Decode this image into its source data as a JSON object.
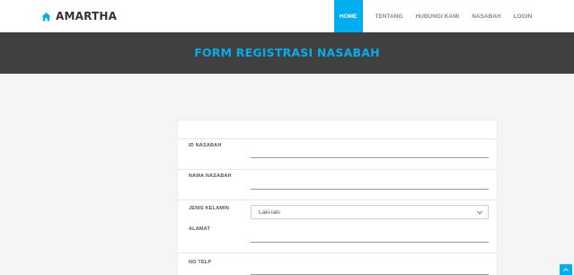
{
  "brand": {
    "name": "AMARTHA",
    "icon": "home-icon"
  },
  "nav": {
    "items": [
      {
        "label": "HOME",
        "active": true
      },
      {
        "label": "TENTANG",
        "active": false
      },
      {
        "label": "HUBUNGI KAMI",
        "active": false
      },
      {
        "label": "NASABAH",
        "active": false
      },
      {
        "label": "LOGIN",
        "active": false
      }
    ]
  },
  "banner": {
    "title": "FORM REGISTRASI NASABAH"
  },
  "form": {
    "id_label": "ID NASABAH",
    "id_value": "",
    "nama_label": "NAMA NASABAH",
    "nama_value": "",
    "gender_label": "JENIS KELAMIN",
    "gender_selected": "Laki-laki",
    "alamat_label": "ALAMAT",
    "alamat_value": "",
    "telp_label": "NO TELP",
    "telp_value": ""
  },
  "scroll_top": {
    "icon": "chevron-up-icon"
  },
  "colors": {
    "accent": "#00adee",
    "banner": "#404040",
    "page": "#f5f5f5"
  }
}
